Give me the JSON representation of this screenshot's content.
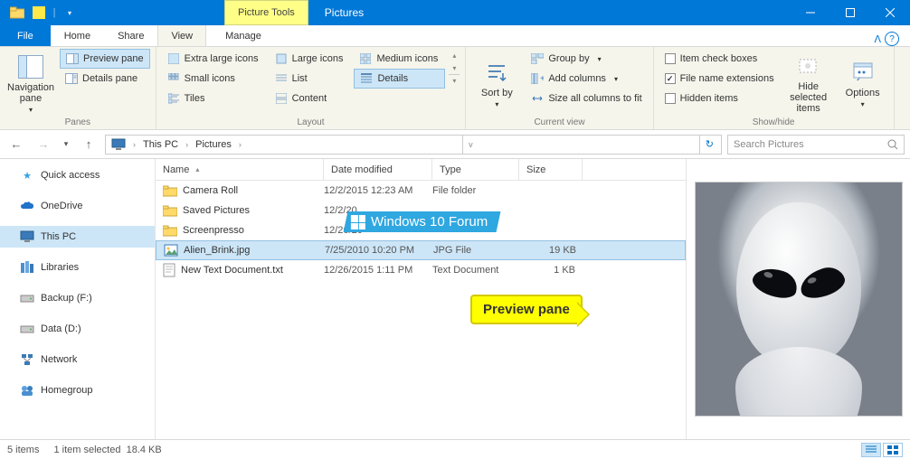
{
  "titlebar": {
    "context_tab": "Picture Tools",
    "title": "Pictures"
  },
  "tabs": {
    "file": "File",
    "home": "Home",
    "share": "Share",
    "view": "View",
    "manage": "Manage"
  },
  "ribbon": {
    "panes": {
      "navigation": "Navigation pane",
      "preview": "Preview pane",
      "details": "Details pane",
      "group": "Panes"
    },
    "layout": {
      "xl": "Extra large icons",
      "large": "Large icons",
      "medium": "Medium icons",
      "small": "Small icons",
      "list": "List",
      "details": "Details",
      "tiles": "Tiles",
      "content": "Content",
      "group": "Layout"
    },
    "currentview": {
      "sortby": "Sort by",
      "groupby": "Group by",
      "addcols": "Add columns",
      "sizecols": "Size all columns to fit",
      "group": "Current view"
    },
    "showhide": {
      "itemcheck": "Item check boxes",
      "fileext": "File name extensions",
      "hidden": "Hidden items",
      "hidesel": "Hide selected items",
      "options": "Options",
      "group": "Show/hide"
    }
  },
  "address": {
    "thispc": "This PC",
    "pictures": "Pictures"
  },
  "search": {
    "placeholder": "Search Pictures"
  },
  "nav": {
    "quick": "Quick access",
    "onedrive": "OneDrive",
    "thispc": "This PC",
    "libraries": "Libraries",
    "backup": "Backup (F:)",
    "data": "Data (D:)",
    "network": "Network",
    "homegroup": "Homegroup"
  },
  "columns": {
    "name": "Name",
    "date": "Date modified",
    "type": "Type",
    "size": "Size"
  },
  "files": [
    {
      "name": "Camera Roll",
      "date": "12/2/2015 12:23 AM",
      "type": "File folder",
      "size": "",
      "icon": "folder"
    },
    {
      "name": "Saved Pictures",
      "date": "12/2/20",
      "type": "",
      "size": "",
      "icon": "folder"
    },
    {
      "name": "Screenpresso",
      "date": "12/26/20",
      "type": "",
      "size": "",
      "icon": "folder"
    },
    {
      "name": "Alien_Brink.jpg",
      "date": "7/25/2010 10:20 PM",
      "type": "JPG File",
      "size": "19 KB",
      "icon": "image"
    },
    {
      "name": "New Text Document.txt",
      "date": "12/26/2015 1:11 PM",
      "type": "Text Document",
      "size": "1 KB",
      "icon": "text"
    }
  ],
  "watermark": "Windows 10 Forum",
  "callout": "Preview pane",
  "status": {
    "count": "5 items",
    "selected": "1 item selected",
    "size": "18.4 KB"
  }
}
